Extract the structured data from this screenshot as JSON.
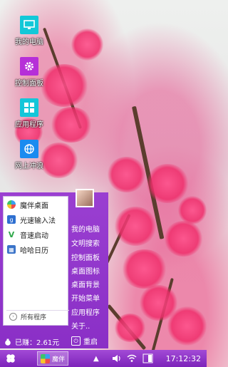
{
  "desktop": {
    "icons": [
      {
        "label": "我的电脑",
        "icon": "monitor-icon",
        "color": "#12c8d8"
      },
      {
        "label": "控制面板",
        "icon": "gear-icon",
        "color": "#b62fd8"
      },
      {
        "label": "应用程序",
        "icon": "apps-grid-icon",
        "color": "#14c6d9"
      },
      {
        "label": "网上冲浪",
        "icon": "globe-icon",
        "color": "#1a8bf0"
      }
    ]
  },
  "start_menu": {
    "recent": [
      {
        "label": "魔伴桌面",
        "icon": "pinwheel-icon"
      },
      {
        "label": "光速输入法",
        "icon": "input-method-icon"
      },
      {
        "label": "音速启动",
        "icon": "launcher-icon"
      },
      {
        "label": "哈哈日历",
        "icon": "calendar-icon"
      }
    ],
    "all_programs_label": "所有程序",
    "right_items": [
      "我的电脑",
      "文明搜索",
      "控制面板",
      "桌面图标",
      "桌面背景",
      "开始菜单",
      "应用程序",
      "关于.."
    ],
    "earned_label": "已赚：2.61元",
    "restart_label": "重启"
  },
  "taskbar": {
    "task_label": "魔伴",
    "clock": "17:12:32"
  },
  "colors": {
    "menu_purple": "#8a2fc6",
    "taskbar_purple": "#7d24ba"
  }
}
